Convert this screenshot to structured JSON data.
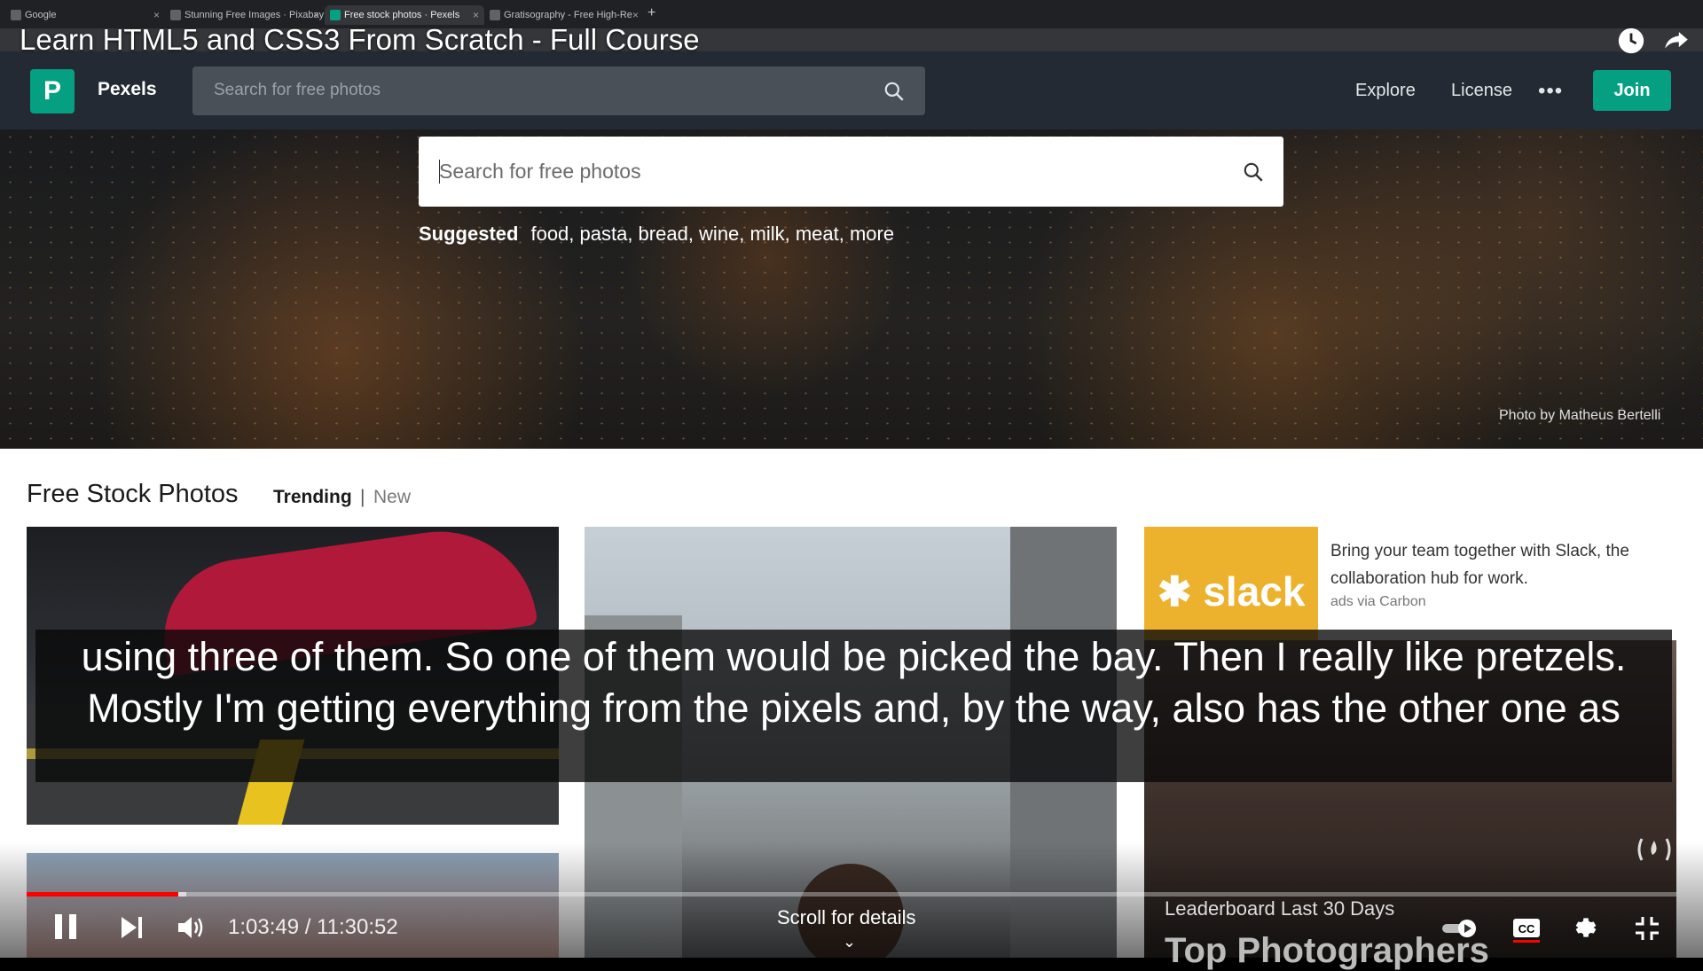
{
  "browser": {
    "tabs": [
      {
        "label": "Google"
      },
      {
        "label": "Stunning Free Images · Pixabay"
      },
      {
        "label": "Free stock photos · Pexels"
      },
      {
        "label": "Gratisography - Free High-Re"
      }
    ],
    "new_tab": "+"
  },
  "video": {
    "title": "Learn HTML5 and CSS3 From Scratch - Full Course",
    "current_time": "1:03:49",
    "duration": "11:30:52",
    "time_display": "1:03:49 / 11:30:52",
    "progress_fraction": 0.092,
    "scroll_for_details": "Scroll for details",
    "caption": "using three of them. So one of them would be picked the bay. Then I really like pretzels. Mostly I'm getting everything from the pixels and, by the way, also has the other one as"
  },
  "pexels": {
    "brand": "Pexels",
    "logo_letter": "P",
    "nav_search_placeholder": "Search for free photos",
    "nav_links": [
      "Explore",
      "License"
    ],
    "more": "•••",
    "join": "Join",
    "hero_search_placeholder": "Search for free photos",
    "suggested_label": "Suggested",
    "suggested_items": "food, pasta, bread, wine, milk, meat, more",
    "photo_credit": "Photo by Matheus Bertelli",
    "section_title": "Free Stock Photos",
    "trending": "Trending",
    "separator": "|",
    "new": "New",
    "ad_brand": "slack",
    "ad_text": "Bring your team together with Slack, the collaboration hub for work.",
    "ad_via": "ads via Carbon",
    "leaderboard": "Leaderboard Last 30 Days",
    "leaderboard_heading": "Top Photographers"
  },
  "colors": {
    "pexels_green": "#05a081",
    "progress_red": "#ff0000",
    "slack_yellow": "#ecb22e"
  }
}
